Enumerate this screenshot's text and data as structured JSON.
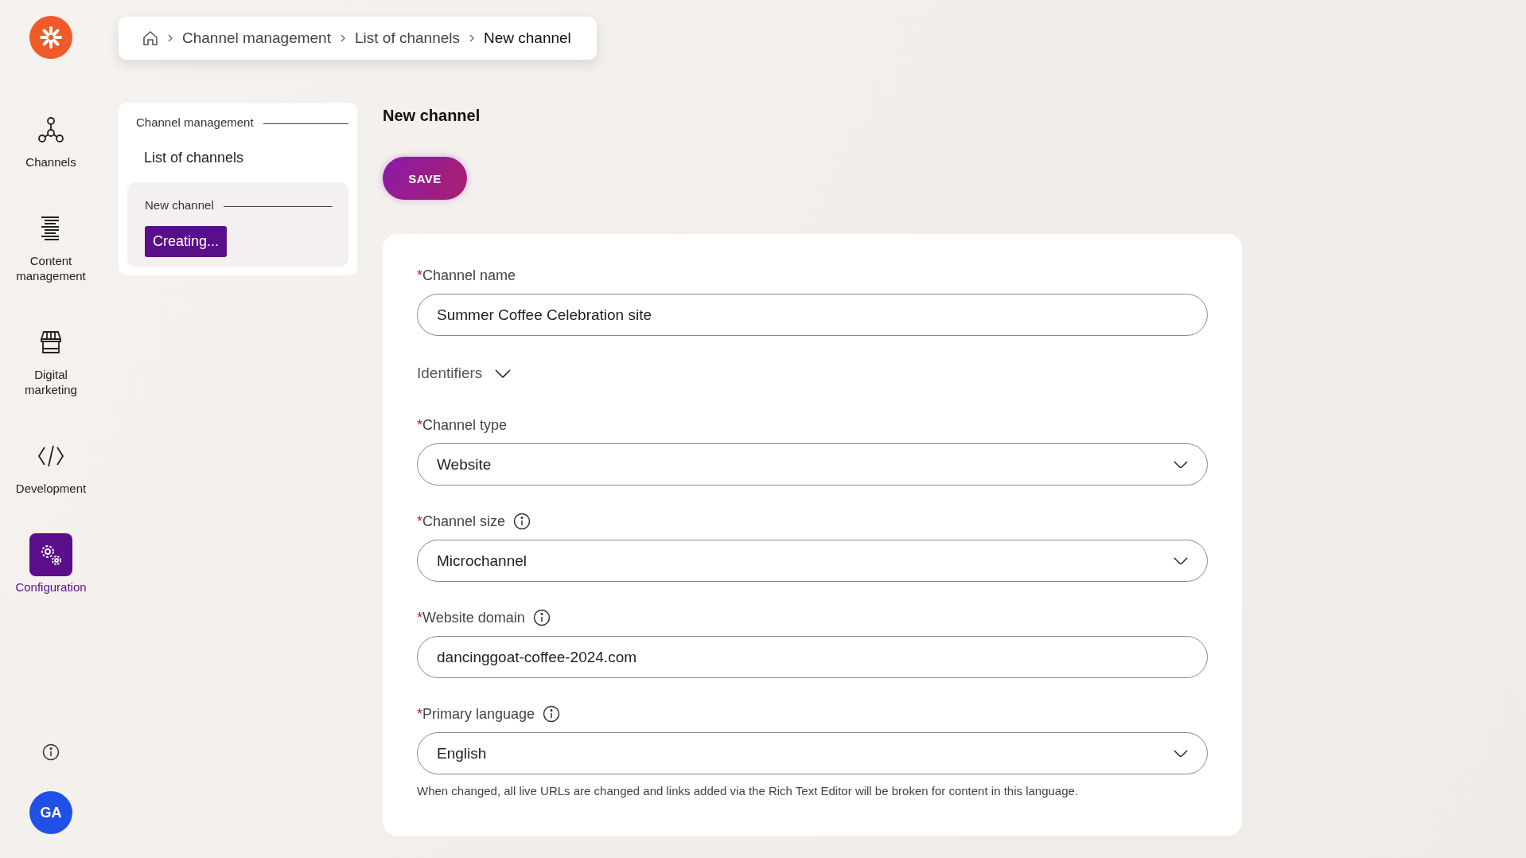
{
  "sidebar": {
    "items": [
      {
        "label": "Channels",
        "selected": false
      },
      {
        "label": "Content management",
        "selected": false
      },
      {
        "label": "Digital marketing",
        "selected": false
      },
      {
        "label": "Development",
        "selected": false
      },
      {
        "label": "Configuration",
        "selected": true
      }
    ],
    "avatar": "GA"
  },
  "breadcrumb": [
    "Channel management",
    "List of channels",
    "New channel"
  ],
  "tree": {
    "label": "Channel management",
    "children": [
      {
        "label": "List of channels",
        "selected": false,
        "children": [
          {
            "label": "New channel",
            "selected": true,
            "badge": "Creating..."
          }
        ]
      }
    ]
  },
  "page": {
    "title": "New channel",
    "save_button": "SAVE"
  },
  "form": {
    "fields": [
      {
        "kind": "text",
        "label": "Channel name",
        "marker": "*",
        "info": false,
        "value": "Summer Coffee Celebration site"
      },
      {
        "kind": "section",
        "label": "Identifiers",
        "expanded": false
      },
      {
        "kind": "select",
        "label": "Channel type",
        "marker": "*",
        "info": false,
        "value": "Website"
      },
      {
        "kind": "select",
        "label": "Channel size",
        "marker": "*",
        "info": true,
        "value": "Microchannel"
      },
      {
        "kind": "text",
        "label": "Website domain",
        "marker": "*",
        "info": true,
        "value": "dancinggoat-coffee-2024.com"
      },
      {
        "kind": "select",
        "label": "Primary language",
        "marker": "*",
        "info": true,
        "value": "English",
        "note": "When changed, all live URLs are changed and links added via the Rich Text Editor will be broken for content in this language."
      }
    ]
  }
}
